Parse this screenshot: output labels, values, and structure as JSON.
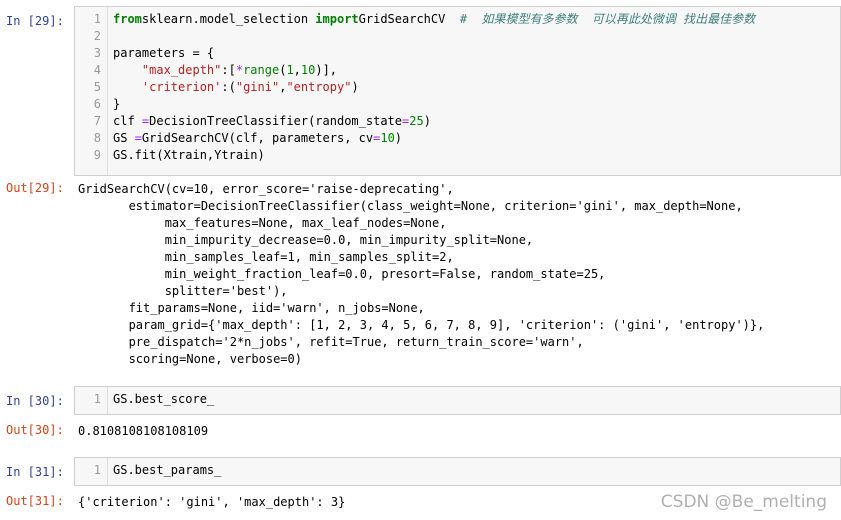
{
  "cells": [
    {
      "in_prompt": "In  [29]:",
      "out_prompt": "Out[29]:",
      "line_numbers": [
        "1",
        "2",
        "3",
        "4",
        "5",
        "6",
        "7",
        "8",
        "9"
      ],
      "code_lines": [
        [
          [
            "kw",
            "from"
          ],
          [
            "",
            "sklearn.model_selection "
          ],
          [
            "kw",
            "import"
          ],
          [
            "",
            "GridSearchCV  "
          ],
          [
            "cm",
            "#  如果模型有多参数  可以再此处微调 找出最佳参数"
          ]
        ],
        [
          [
            "",
            ""
          ]
        ],
        [
          [
            "",
            "parameters = {"
          ]
        ],
        [
          [
            "",
            "    "
          ],
          [
            "st",
            "\"max_depth\""
          ],
          [
            "",
            ":["
          ],
          [
            "op",
            "*"
          ],
          [
            "bi",
            "range"
          ],
          [
            "",
            "("
          ],
          [
            "nu",
            "1"
          ],
          [
            "",
            ","
          ],
          [
            "nu",
            "10"
          ],
          [
            "",
            ")],"
          ]
        ],
        [
          [
            "",
            "    "
          ],
          [
            "st",
            "'criterion'"
          ],
          [
            "",
            ":("
          ],
          [
            "st",
            "\"gini\""
          ],
          [
            "",
            ","
          ],
          [
            "st",
            "\"entropy\""
          ],
          [
            "",
            ")"
          ]
        ],
        [
          [
            "",
            "}"
          ]
        ],
        [
          [
            "",
            "clf "
          ],
          [
            "op",
            "="
          ],
          [
            "",
            "DecisionTreeClassifier(random_state"
          ],
          [
            "op",
            "="
          ],
          [
            "nu",
            "25"
          ],
          [
            "",
            ")"
          ]
        ],
        [
          [
            "",
            "GS "
          ],
          [
            "op",
            "="
          ],
          [
            "",
            "GridSearchCV(clf, parameters, cv"
          ],
          [
            "op",
            "="
          ],
          [
            "nu",
            "10"
          ],
          [
            "",
            ")"
          ]
        ],
        [
          [
            "",
            "GS.fit(Xtrain,Ytrain)"
          ]
        ]
      ],
      "output_lines": [
        "GridSearchCV(cv=10, error_score='raise-deprecating',",
        "       estimator=DecisionTreeClassifier(class_weight=None, criterion='gini', max_depth=None,",
        "            max_features=None, max_leaf_nodes=None,",
        "            min_impurity_decrease=0.0, min_impurity_split=None,",
        "            min_samples_leaf=1, min_samples_split=2,",
        "            min_weight_fraction_leaf=0.0, presort=False, random_state=25,",
        "            splitter='best'),",
        "       fit_params=None, iid='warn', n_jobs=None,",
        "       param_grid={'max_depth': [1, 2, 3, 4, 5, 6, 7, 8, 9], 'criterion': ('gini', 'entropy')},",
        "       pre_dispatch='2*n_jobs', refit=True, return_train_score='warn',",
        "       scoring=None, verbose=0)"
      ]
    },
    {
      "in_prompt": "In  [30]:",
      "out_prompt": "Out[30]:",
      "line_numbers": [
        "1"
      ],
      "code_lines": [
        [
          [
            "",
            "GS.best_score_"
          ]
        ]
      ],
      "output_lines": [
        "0.8108108108108109"
      ]
    },
    {
      "in_prompt": "In  [31]:",
      "out_prompt": "Out[31]:",
      "line_numbers": [
        "1"
      ],
      "code_lines": [
        [
          [
            "",
            "GS.best_params_"
          ]
        ]
      ],
      "output_lines": [
        "{'criterion': 'gini', 'max_depth': 3}"
      ]
    }
  ],
  "watermark": "CSDN @Be_melting"
}
